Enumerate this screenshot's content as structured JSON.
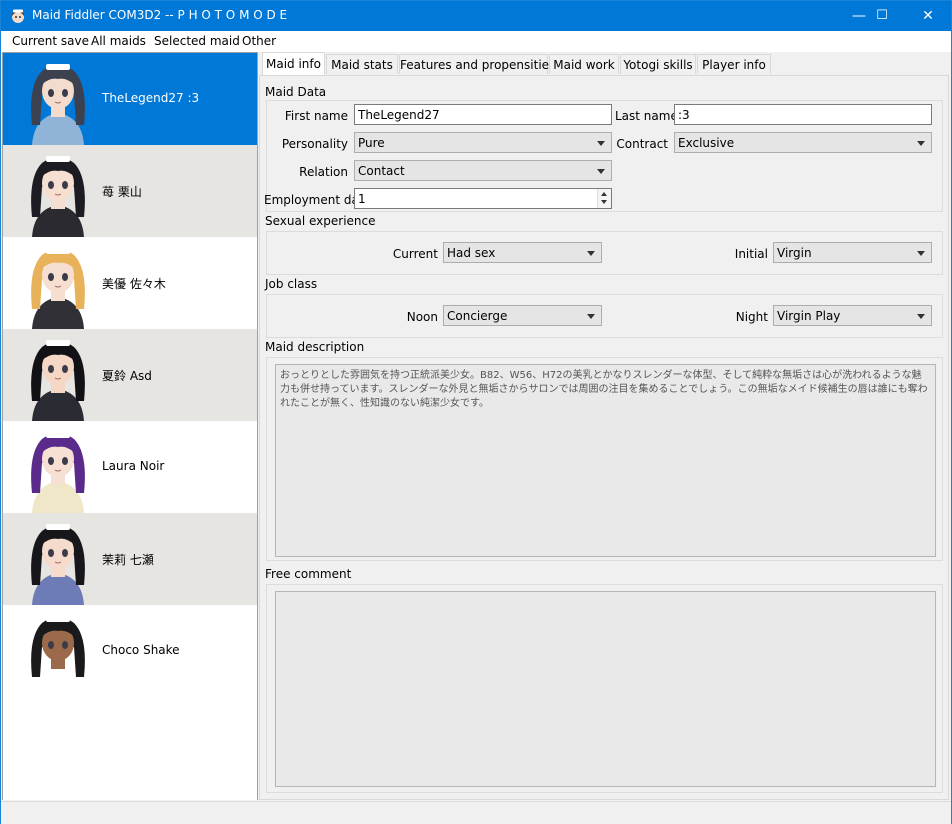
{
  "window": {
    "title": "Maid Fiddler COM3D2 -- P H O T O  M O D E",
    "minimize": "—",
    "maximize": "☐",
    "close": "✕"
  },
  "menu": [
    "Current save",
    "All maids",
    "Selected maid",
    "Other"
  ],
  "maids": [
    {
      "name": "TheLegend27 :3",
      "hair": "#3c4150",
      "skin": "#f3dccd",
      "outfit": "#8fb4d8",
      "selected": true
    },
    {
      "name": "苺 栗山",
      "hair": "#1c1c22",
      "skin": "#f6dfd1",
      "outfit": "#2a2a30",
      "selected": false
    },
    {
      "name": "美優 佐々木",
      "hair": "#e8b25a",
      "skin": "#f6dfd1",
      "outfit": "#303036",
      "selected": false
    },
    {
      "name": "夏鈴 Asd",
      "hair": "#121216",
      "skin": "#f4d7c4",
      "outfit": "#2b2b33",
      "selected": false
    },
    {
      "name": "Laura Noir",
      "hair": "#5a2b8a",
      "skin": "#f6e0d4",
      "outfit": "#efe7c8",
      "selected": false
    },
    {
      "name": "茉莉 七瀬",
      "hair": "#16161b",
      "skin": "#f5dbcb",
      "outfit": "#6d7bb6",
      "selected": false
    },
    {
      "name": "Choco Shake",
      "hair": "#1a1a1d",
      "skin": "#9b6a4b",
      "outfit": "#ffffff",
      "selected": false
    }
  ],
  "tabs": [
    "Maid info",
    "Maid stats",
    "Features and propensities",
    "Maid work",
    "Yotogi skills",
    "Player info"
  ],
  "maid_data": {
    "section": "Maid Data",
    "first_name_label": "First name",
    "first_name": "TheLegend27",
    "last_name_label": "Last name",
    "last_name": ":3",
    "personality_label": "Personality",
    "personality": "Pure",
    "contract_label": "Contract",
    "contract": "Exclusive",
    "relation_label": "Relation",
    "relation": "Contact",
    "employment_label": "Employment day",
    "employment": "1"
  },
  "sexual_experience": {
    "section": "Sexual experience",
    "current_label": "Current",
    "current": "Had sex",
    "initial_label": "Initial",
    "initial": "Virgin"
  },
  "job_class": {
    "section": "Job class",
    "noon_label": "Noon",
    "noon": "Concierge",
    "night_label": "Night",
    "night": "Virgin Play"
  },
  "description": {
    "section": "Maid description",
    "text": "おっとりとした雰囲気を持つ正統派美少女。B82、W56、H72の美乳とかなりスレンダーな体型、そして純粋な無垢さは心が洗われるような魅力も併せ持っています。スレンダーな外見と無垢さからサロンでは周囲の注目を集めることでしょう。この無垢なメイド候補生の唇は誰にも奪われたことが無く、性知識のない純潔少女です。"
  },
  "comment": {
    "section": "Free comment",
    "text": ""
  }
}
